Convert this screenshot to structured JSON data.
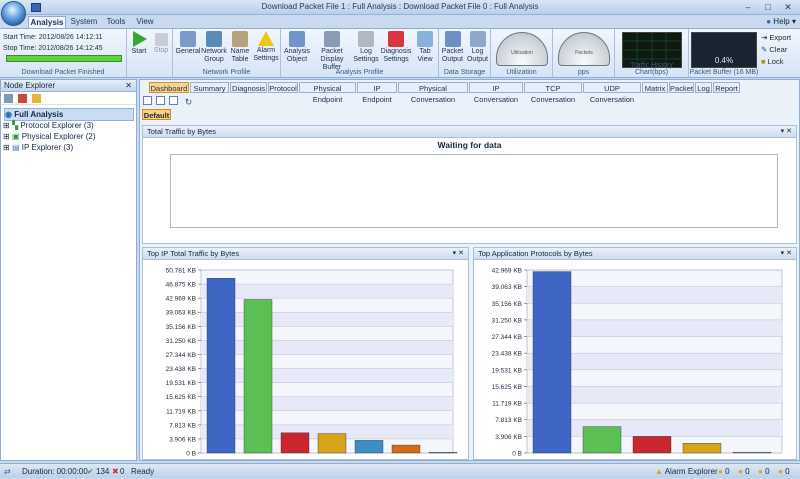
{
  "window": {
    "title": "Download Packet File 1 : Full Analysis : Download Packet File 0 : Full Analysis"
  },
  "tabs": [
    "Analysis",
    "System",
    "Tools",
    "View"
  ],
  "help": "Help",
  "ribbon": {
    "start_time": "Start Time: 2012/08/26 14:12:11",
    "stop_time": "Stop Time: 2012/08/26 14:12:45",
    "progress": 1.0,
    "download_label": "Download Packet Finished",
    "start": "Start",
    "stop": "Stop",
    "general": "General",
    "network_group": "Network Group",
    "name_table": "Name Table",
    "alarm_settings": "Alarm Settings",
    "network_profile": "Network Profile",
    "analysis_object": "Analysis Object",
    "packet_display_buffer": "Packet Display Buffer",
    "log_settings": "Log Settings",
    "diagnosis_settings": "Diagnosis Settings",
    "tab_view": "Tab View",
    "analysis_profile": "Analysis Profile",
    "packet_output": "Packet Output",
    "log_output": "Log Output",
    "data_storage": "Data Storage",
    "utilization": "Utilization",
    "pps": "pps",
    "traffic_history": "Traffic History Chart(bps)",
    "buffer_pct": "0.4%",
    "packet_buffer": "Packet Buffer (16 MB)",
    "export": "Export",
    "clear": "Clear",
    "lock": "Lock"
  },
  "node_explorer": {
    "title": "Node Explorer",
    "root": "Full Analysis",
    "items": [
      "Protocol Explorer (3)",
      "Physical Explorer (2)",
      "IP Explorer (3)"
    ]
  },
  "doc_tabs": [
    "Dashboard",
    "Summary",
    "Diagnosis",
    "Protocol",
    "Physical Endpoint",
    "IP Endpoint",
    "Physical Conversation",
    "IP Conversation",
    "TCP Conversation",
    "UDP Conversation",
    "Matrix",
    "Packet",
    "Log",
    "Report"
  ],
  "default_btn": "Default",
  "total_traffic": {
    "title": "Total Traffic by Bytes",
    "waiting": "Waiting for data"
  },
  "ip_chart": {
    "title": "Top IP Total Traffic by Bytes"
  },
  "app_chart": {
    "title": "Top Application Protocols by Bytes"
  },
  "chart_data": [
    {
      "type": "bar",
      "title": "Top IP Total Traffic by Bytes",
      "yticks": [
        "50.781 KB",
        "46.875 KB",
        "42.969 KB",
        "39.063 KB",
        "35.156 KB",
        "31.250 KB",
        "27.344 KB",
        "23.438 KB",
        "19.531 KB",
        "15.625 KB",
        "11.719 KB",
        "7.813 KB",
        "3.906 KB",
        "0 B"
      ],
      "ylim": [
        0,
        50.781
      ],
      "values": [
        48.5,
        42.6,
        5.6,
        5.4,
        3.5,
        2.2,
        0.2
      ],
      "colors": [
        "#3e66c4",
        "#5cbf52",
        "#c9262e",
        "#d8a21a",
        "#3e8ec4",
        "#d76a15",
        "#8aa0bf"
      ]
    },
    {
      "type": "bar",
      "title": "Top Application Protocols by Bytes",
      "yticks": [
        "42.969 KB",
        "39.063 KB",
        "35.156 KB",
        "31.250 KB",
        "27.344 KB",
        "23.438 KB",
        "19.531 KB",
        "15.625 KB",
        "11.719 KB",
        "7.813 KB",
        "3.906 KB",
        "0 B"
      ],
      "ylim": [
        0,
        42.969
      ],
      "values": [
        42.6,
        6.2,
        3.9,
        2.3,
        0.2
      ],
      "colors": [
        "#3e66c4",
        "#5cbf52",
        "#c9262e",
        "#d8a21a",
        "#8aa0bf"
      ]
    }
  ],
  "status": {
    "duration": "Duration: 00:00:00",
    "count1": "134",
    "count2": "0",
    "ready": "Ready",
    "alarm": "Alarm Explorer",
    "a1": "0",
    "a2": "0",
    "a3": "0",
    "a4": "0"
  }
}
